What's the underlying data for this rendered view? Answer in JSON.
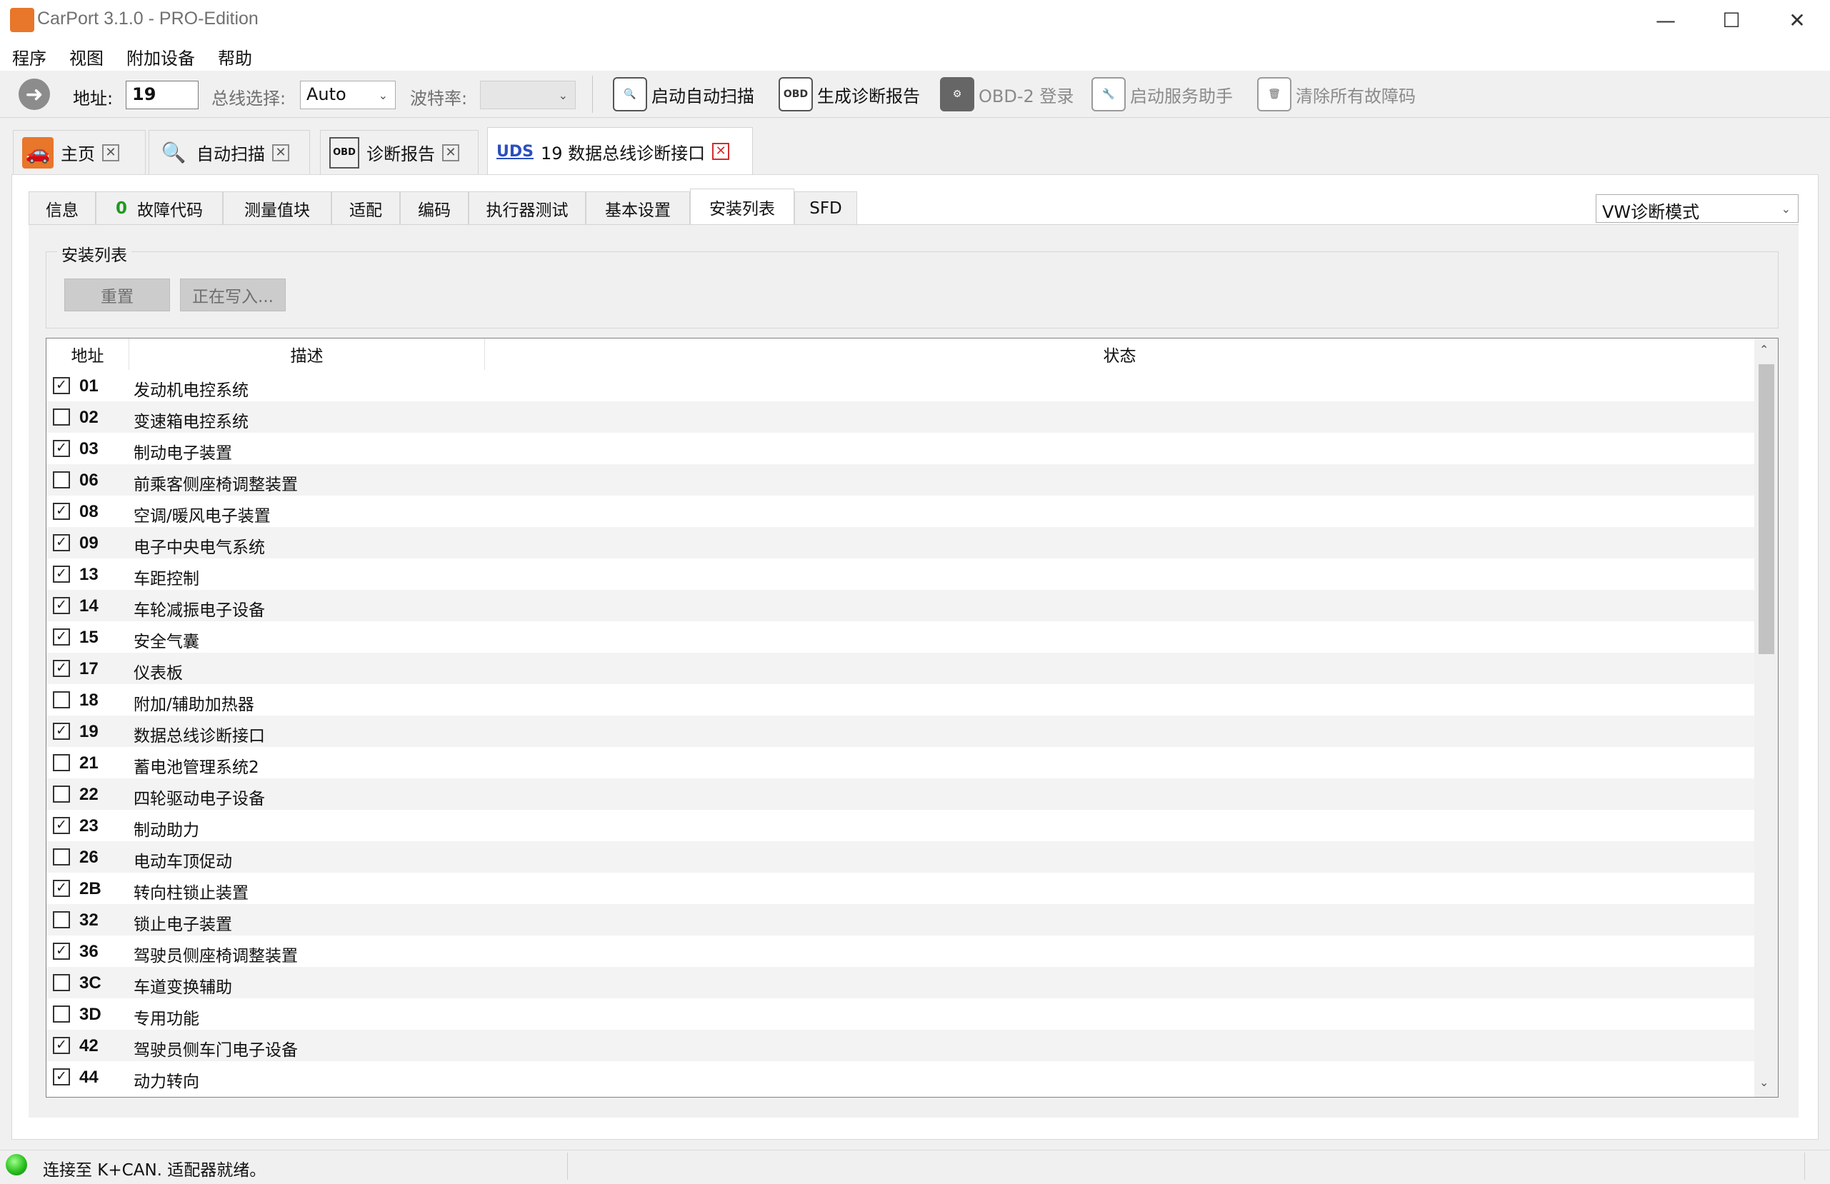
{
  "window": {
    "title": "CarPort 3.1.0 - PRO-Edition",
    "minimize": "—",
    "maximize": "☐",
    "close": "✕"
  },
  "menu": [
    "程序",
    "视图",
    "附加设备",
    "帮助"
  ],
  "toolbar": {
    "address_label": "地址:",
    "address_value": "19",
    "bus_label": "总线选择:",
    "bus_value": "Auto",
    "baud_label": "波特率:",
    "baud_value": "",
    "buttons": [
      "启动自动扫描",
      "生成诊断报告",
      "OBD-2 登录",
      "启动服务助手",
      "清除所有故障码"
    ]
  },
  "doc_tabs": [
    {
      "label": "主页"
    },
    {
      "label": "自动扫描"
    },
    {
      "label": "诊断报告"
    },
    {
      "prefix": "UDS",
      "label": "19 数据总线诊断接口"
    }
  ],
  "sub_tabs": {
    "info": "信息",
    "fault_count": "0",
    "fault_label": "故障代码",
    "measure": "测量值块",
    "adapt": "适配",
    "coding": "编码",
    "actuator": "执行器测试",
    "basic": "基本设置",
    "install": "安装列表",
    "sfd": "SFD"
  },
  "mode_select": "VW诊断模式",
  "group": {
    "title": "安装列表",
    "reset": "重置",
    "writing": "正在写入..."
  },
  "columns": {
    "address": "地址",
    "description": "描述",
    "status": "状态"
  },
  "rows": [
    {
      "checked": true,
      "addr": "01",
      "desc": "发动机电控系统"
    },
    {
      "checked": false,
      "addr": "02",
      "desc": "变速箱电控系统"
    },
    {
      "checked": true,
      "addr": "03",
      "desc": "制动电子装置"
    },
    {
      "checked": false,
      "addr": "06",
      "desc": "前乘客侧座椅调整装置"
    },
    {
      "checked": true,
      "addr": "08",
      "desc": "空调/暖风电子装置"
    },
    {
      "checked": true,
      "addr": "09",
      "desc": "电子中央电气系统"
    },
    {
      "checked": true,
      "addr": "13",
      "desc": "车距控制"
    },
    {
      "checked": true,
      "addr": "14",
      "desc": "车轮减振电子设备"
    },
    {
      "checked": true,
      "addr": "15",
      "desc": "安全气囊"
    },
    {
      "checked": true,
      "addr": "17",
      "desc": "仪表板"
    },
    {
      "checked": false,
      "addr": "18",
      "desc": "附加/辅助加热器"
    },
    {
      "checked": true,
      "addr": "19",
      "desc": "数据总线诊断接口"
    },
    {
      "checked": false,
      "addr": "21",
      "desc": "蓄电池管理系统2"
    },
    {
      "checked": false,
      "addr": "22",
      "desc": "四轮驱动电子设备"
    },
    {
      "checked": true,
      "addr": "23",
      "desc": "制动助力"
    },
    {
      "checked": false,
      "addr": "26",
      "desc": "电动车顶促动"
    },
    {
      "checked": true,
      "addr": "2B",
      "desc": "转向柱锁止装置"
    },
    {
      "checked": false,
      "addr": "32",
      "desc": "锁止电子装置"
    },
    {
      "checked": true,
      "addr": "36",
      "desc": "驾驶员侧座椅调整装置"
    },
    {
      "checked": false,
      "addr": "3C",
      "desc": "车道变换辅助"
    },
    {
      "checked": false,
      "addr": "3D",
      "desc": "专用功能"
    },
    {
      "checked": true,
      "addr": "42",
      "desc": "驾驶员侧车门电子设备"
    },
    {
      "checked": true,
      "addr": "44",
      "desc": "动力转向"
    }
  ],
  "status": {
    "text": "连接至 K+CAN. 适配器就绪。"
  }
}
